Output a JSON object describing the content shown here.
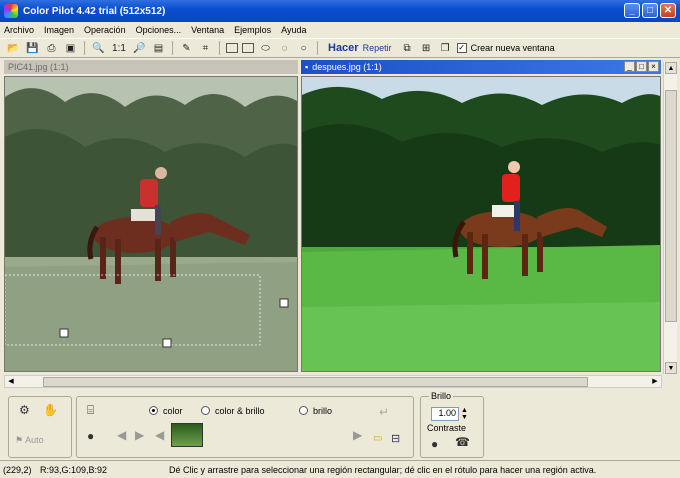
{
  "window": {
    "title": "Color Pilot 4.42 trial (512x512)"
  },
  "menu": [
    "Archivo",
    "Imagen",
    "Operación",
    "Opciones...",
    "Ventana",
    "Ejemplos",
    "Ayuda"
  ],
  "toolbar": {
    "zoom_label": "1:1",
    "hacer_label": "Hacer",
    "repetir_label": "Repetir",
    "new_window_label": "Crear nueva ventana",
    "new_window_checked": true
  },
  "left_pane": {
    "title": "PIC41.jpg (1:1)"
  },
  "right_pane": {
    "title": "despues.jpg (1:1)"
  },
  "bottom": {
    "auto_label": "Auto",
    "radio_color": "color",
    "radio_color_brillo": "color & brillo",
    "radio_brillo": "brillo",
    "brillo_label": "Brillo",
    "brillo_value": "1.00",
    "contraste_label": "Contraste"
  },
  "status": {
    "coords": "(229,2)",
    "rgb": "R:93,G:109,B:92",
    "message": "Dé Clic y arrastre para seleccionar una región rectangular; dé clic en el rótulo para hacer una región activa."
  },
  "colors": {
    "title_blue": "#0a4fd0",
    "active_pane": "#1d4fc7"
  }
}
